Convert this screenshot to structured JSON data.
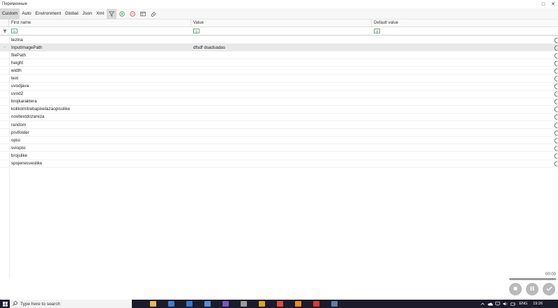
{
  "window": {
    "title": "Переменные",
    "maximize_glyph": "□",
    "close_glyph": "✕"
  },
  "tabs": [
    {
      "label": "Custom",
      "active": true
    },
    {
      "label": "Auto"
    },
    {
      "label": "Environment"
    },
    {
      "label": "Global"
    },
    {
      "label": "Json"
    },
    {
      "label": "Xml"
    }
  ],
  "toolbar_icons": [
    "filter-icon",
    "add-icon",
    "remove-icon",
    "window-icon",
    "eraser-icon"
  ],
  "columns": {
    "name": "First name",
    "value": "Value",
    "default": "Default value"
  },
  "rows": [
    {
      "name": "tezina",
      "value": ""
    },
    {
      "name": "InputImagePath",
      "value": "dfsdf dsadsadas",
      "selected": true
    },
    {
      "name": "filePath",
      "value": ""
    },
    {
      "name": "height",
      "value": ""
    },
    {
      "name": "width",
      "value": ""
    },
    {
      "name": "text",
      "value": ""
    },
    {
      "name": "uvodjava",
      "value": ""
    },
    {
      "name": "uvod2",
      "value": ""
    },
    {
      "name": "brojkaraktera",
      "value": ""
    },
    {
      "name": "kolikomitrebapixelazaopisslike",
      "value": ""
    },
    {
      "name": "novitextdozareza",
      "value": ""
    },
    {
      "name": "random",
      "value": ""
    },
    {
      "name": "prvifolder",
      "value": ""
    },
    {
      "name": "opisi",
      "value": ""
    },
    {
      "name": "sviopisi",
      "value": ""
    },
    {
      "name": "brojslike",
      "value": ""
    },
    {
      "name": "spojenesveslike",
      "value": ""
    }
  ],
  "player": {
    "time": "00:00",
    "progress": 0.98
  },
  "taskbar": {
    "search_placeholder": "Type here to search",
    "language": "ENG",
    "time": "19:26",
    "apps": [
      {
        "name": "explorer-app-icon",
        "color": "#e8b84a"
      },
      {
        "name": "paint-app-icon",
        "color": "#3c7fd6"
      },
      {
        "name": "edge-app-icon",
        "color": "#2e7bd1"
      },
      {
        "name": "mail-app-icon",
        "color": "#4d8fe0"
      },
      {
        "name": "store-app-icon",
        "color": "#7a54c4"
      },
      {
        "name": "calculator-app-icon",
        "color": "#9a9a9a"
      },
      {
        "name": "files-app-icon",
        "color": "#e0a020"
      },
      {
        "name": "chrome-app-icon",
        "color": "#e14a3b"
      },
      {
        "name": "vlc-app-icon",
        "color": "#f08a1c"
      },
      {
        "name": "recorder-app-icon",
        "color": "#d93a2f"
      },
      {
        "name": "network-app-icon",
        "color": "#5a7ea6"
      }
    ]
  },
  "colors": {
    "accent_green": "#3da35d",
    "accent_red": "#d9534f",
    "taskbar": "#1b1b2b"
  }
}
